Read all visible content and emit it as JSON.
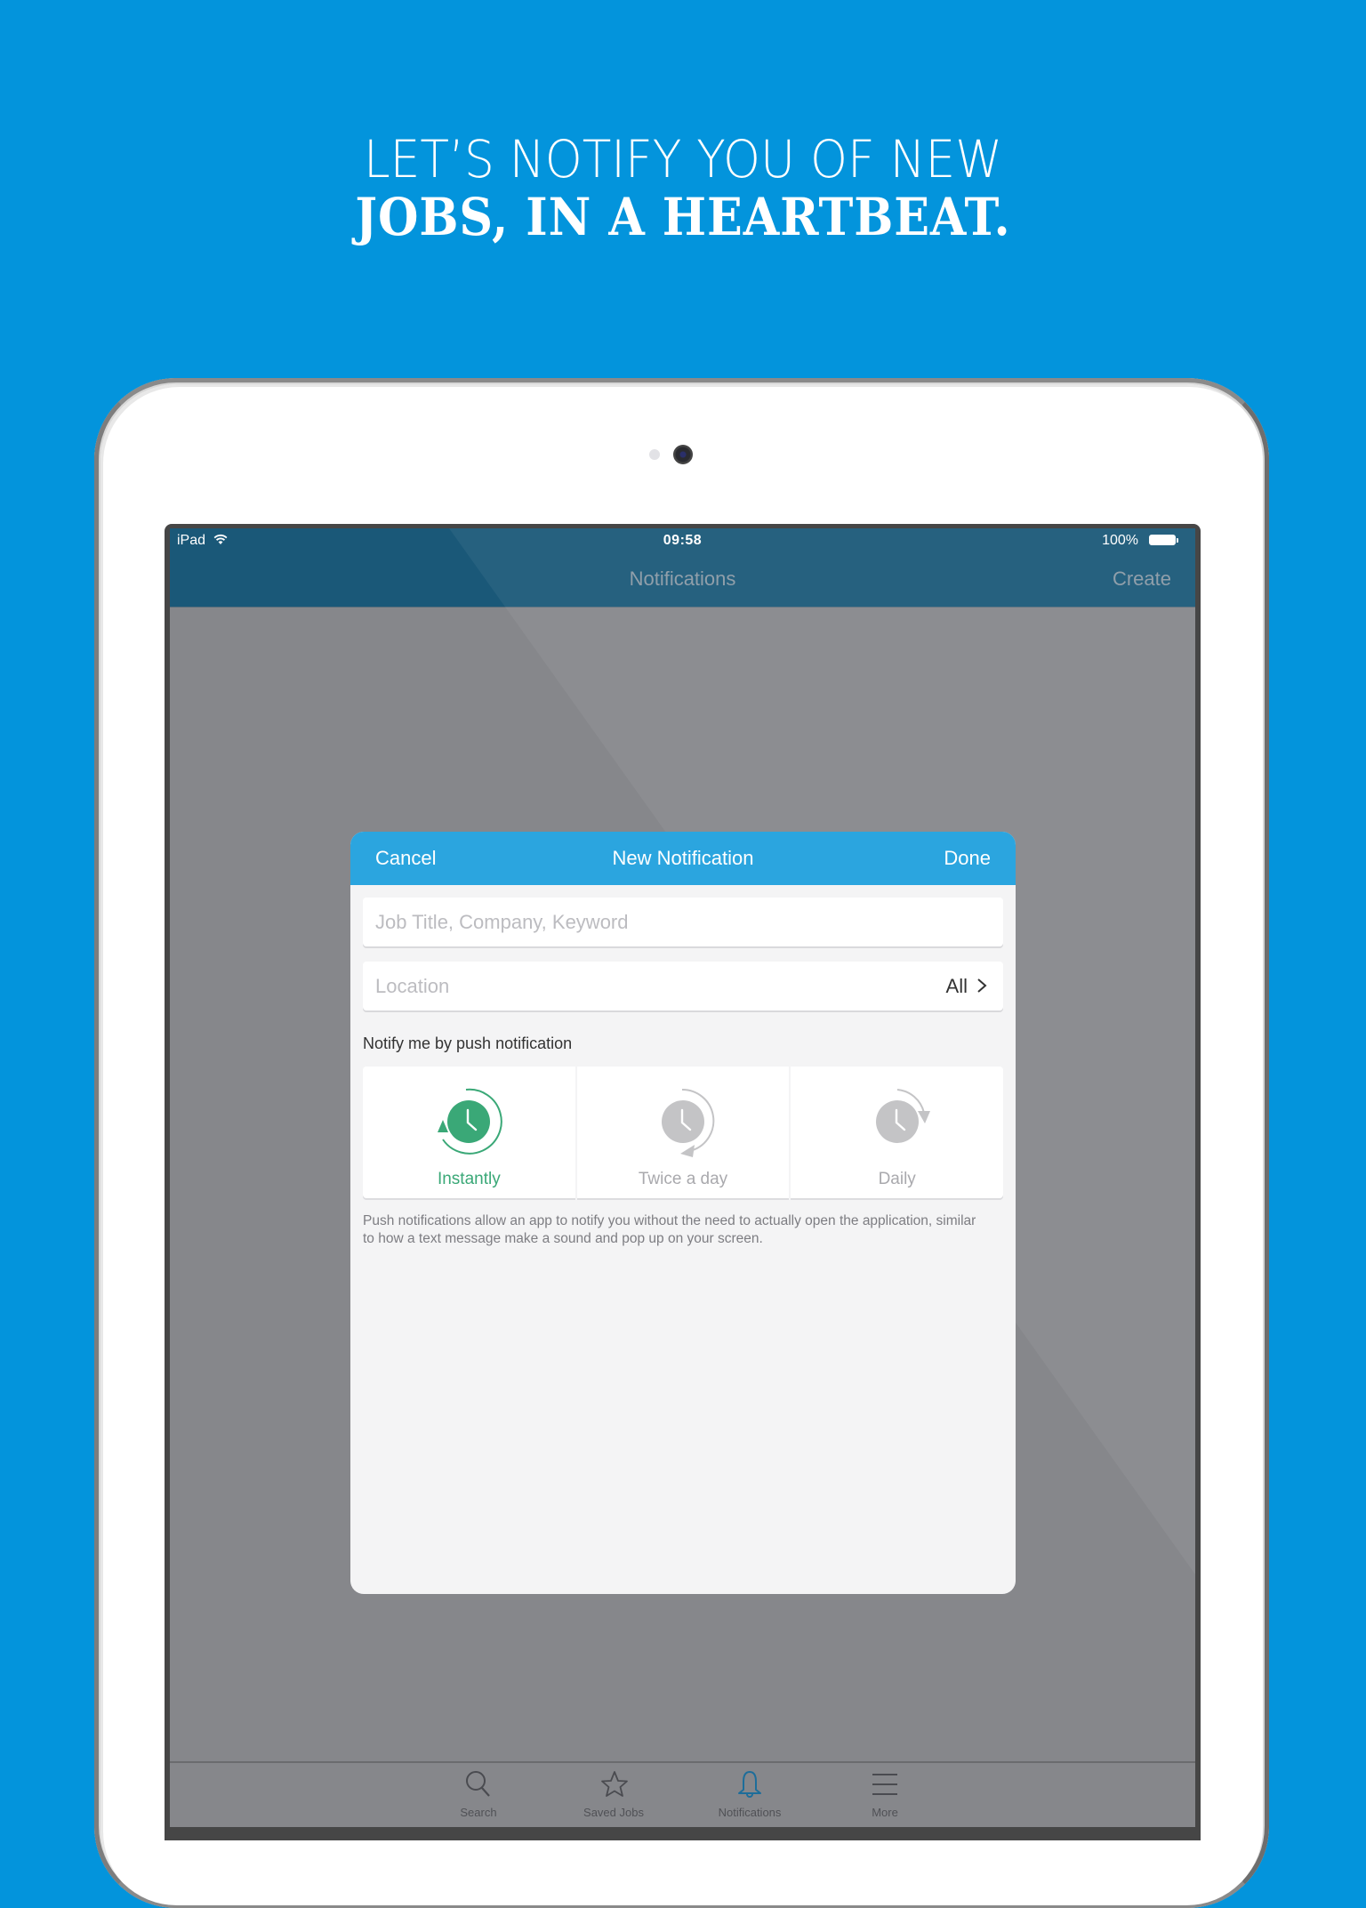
{
  "headline": {
    "line1": "LET’S NOTIFY YOU OF NEW",
    "line2": "JOBS, IN A HEARTBEAT."
  },
  "status_bar": {
    "carrier": "iPad",
    "time": "09:58",
    "battery_percent": "100%",
    "battery_level": 1.0
  },
  "nav_bar": {
    "title": "Notifications",
    "action": "Create"
  },
  "modal": {
    "cancel_label": "Cancel",
    "title": "New Notification",
    "done_label": "Done",
    "keyword_field": {
      "value": "",
      "placeholder": "Job Title, Company, Keyword"
    },
    "location_field": {
      "label": "Location",
      "value": "All"
    },
    "section_label": "Notify me by push notification",
    "frequency_options": [
      {
        "label": "Instantly",
        "icon": "clock-instant-icon",
        "selected": true
      },
      {
        "label": "Twice a day",
        "icon": "clock-twice-icon",
        "selected": false
      },
      {
        "label": "Daily",
        "icon": "clock-daily-icon",
        "selected": false
      }
    ],
    "help_text": "Push notifications allow an app to notify you without the need to actually open the application, similar to how a text message make a sound and pop up on your screen."
  },
  "tab_bar": {
    "items": [
      {
        "label": "Search",
        "icon": "search-icon",
        "active": false
      },
      {
        "label": "Saved Jobs",
        "icon": "star-icon",
        "active": false
      },
      {
        "label": "Notifications",
        "icon": "bell-icon",
        "active": true
      },
      {
        "label": "More",
        "icon": "menu-icon",
        "active": false
      }
    ]
  },
  "colors": {
    "background": "#0394dc",
    "nav_bar": "#1a5878",
    "modal_header": "#2ba5df",
    "selected_green": "#3aa877",
    "inactive_gray": "#c4c4c6",
    "active_tab": "#1d6d9a"
  }
}
